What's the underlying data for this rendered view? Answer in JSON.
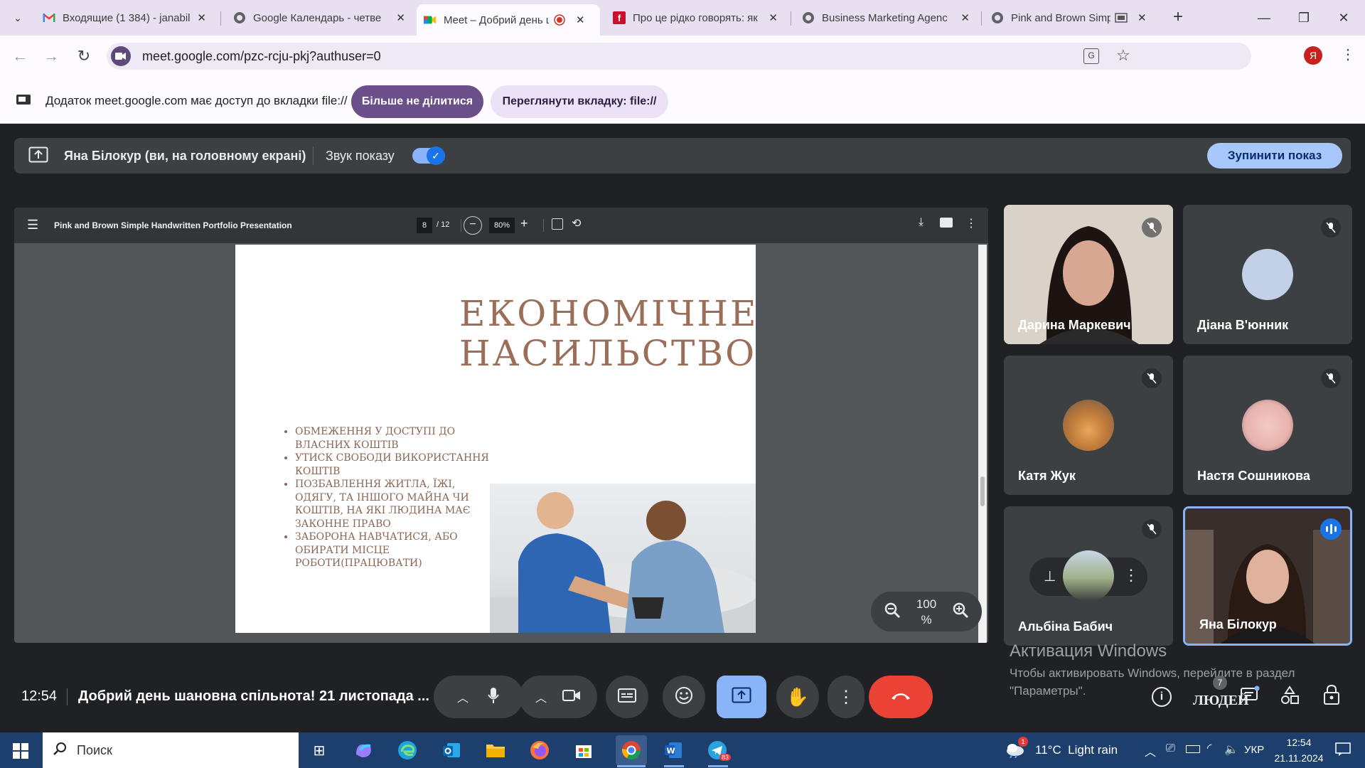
{
  "browser": {
    "tabs": [
      {
        "title": "Входящие (1 384) - janabil",
        "icon": "gmail-icon"
      },
      {
        "title": "Google Календарь - четве",
        "icon": "globe-icon"
      },
      {
        "title": "Meet – Добрий день ш",
        "icon": "meet-icon",
        "active": true
      },
      {
        "title": "Про це рідко говорять: як",
        "icon": "f-icon"
      },
      {
        "title": "Business Marketing Agenc",
        "icon": "globe-icon"
      },
      {
        "title": "Pink and Brown Simple",
        "icon": "globe-icon"
      }
    ],
    "url": "meet.google.com/pzc-rcju-pkj?authuser=0",
    "profile_initial": "Я"
  },
  "infobar": {
    "message": "Додаток meet.google.com має доступ до вкладки file://",
    "stop_sharing": "Більше не ділитися",
    "view_tab": "Переглянути вкладку: file://"
  },
  "share_banner": {
    "presenter": "Яна Білокур (ви, на головному екрані)",
    "audio_label": "Звук показу",
    "stop_button": "Зупинити показ"
  },
  "pdf": {
    "title": "Pink and Brown Simple Handwritten Portfolio Presentation",
    "page_current": "8",
    "page_total": "/ 12",
    "zoom": "80%",
    "viewer_zoom_value": "100",
    "viewer_zoom_unit": "%",
    "slide": {
      "title_line1": "ЕКОНОМІЧНЕ",
      "title_line2": "НАСИЛЬСТВО",
      "bullets": [
        "Обмеження у доступі до власних коштів",
        "Утиск свободи використання коштів",
        "Позбавлення житла, їжі, одягу, та іншого майна чи коштів, на які людина має законне право",
        "Заборона навчатися, або обирати місце роботи(працювати)"
      ]
    }
  },
  "participants": [
    {
      "name": "Дарина Маркевич",
      "muted": true
    },
    {
      "name": "Діана В'юнник",
      "muted": true
    },
    {
      "name": "Катя Жук",
      "muted": true
    },
    {
      "name": "Настя Сошникова",
      "muted": true
    },
    {
      "name": "Альбіна Бабич",
      "muted": true
    },
    {
      "name": "Яна Білокур",
      "muted": false
    }
  ],
  "meeting": {
    "time": "12:54",
    "title": "Добрий день шановна спільнота! 21 листопада ...",
    "people_label": "ЛЮДЕЙ",
    "people_count": "7"
  },
  "watermark": {
    "line1": "Активация Windows",
    "line2": "Чтобы активировать Windows, перейдите в раздел",
    "line3": "\"Параметры\"."
  },
  "taskbar": {
    "search_placeholder": "Поиск",
    "weather": "11°C  Light rain",
    "weather_badge": "1",
    "language": "УКР",
    "time": "12:54",
    "date": "21.11.2024",
    "telegram_badge": "83"
  },
  "colors": {
    "accent_blue": "#a8c7fa",
    "hangup_red": "#ea4335",
    "share_active": "#8ab4f8",
    "slide_text": "#9b6e5a"
  }
}
